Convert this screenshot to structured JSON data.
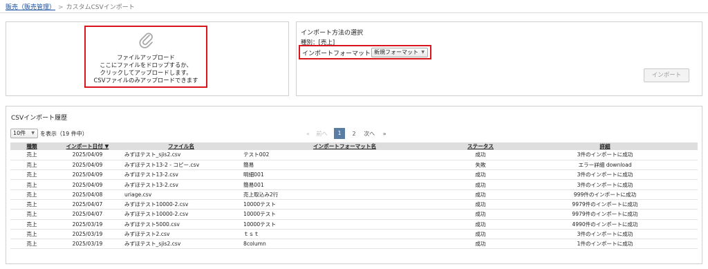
{
  "breadcrumb": {
    "root": "販売（販売管理）",
    "separator": ">",
    "current": "カスタムCSVインポート"
  },
  "upload": {
    "icon": "paperclip-icon",
    "title": "ファイルアップロード",
    "line1": "ここにファイルをドロップするか、",
    "line2": "クリックしてアップロードします。",
    "line3": "CSVファイルのみアップロードできます"
  },
  "import_method": {
    "title": "インポート方法の選択",
    "type_label": "種別：[売上]",
    "format_label": "インポートフォーマット：",
    "format_value": "新規フォーマット",
    "import_button": "インポート"
  },
  "history": {
    "title": "CSVインポート履歴",
    "per_page_value": "10件",
    "per_page_suffix": "を表示（19 件中）",
    "pager": {
      "first": "«",
      "prev": "前へ",
      "pages": [
        "1",
        "2"
      ],
      "current_page": "1",
      "next": "次へ",
      "last": "»"
    },
    "columns": [
      "種類",
      "インポート日付 ▼",
      "ファイル名",
      "インポートフォーマット名",
      "ステータス",
      "詳細"
    ],
    "rows": [
      [
        "売上",
        "2025/04/09",
        "みずほテスト_sjis2.csv",
        "テスト002",
        "成功",
        "3件のインポートに成功"
      ],
      [
        "売上",
        "2025/04/09",
        "みずほテスト13-2 - コピー.csv",
        "簡易",
        "失敗",
        "エラー詳細 download"
      ],
      [
        "売上",
        "2025/04/09",
        "みずほテスト13-2.csv",
        "明細001",
        "成功",
        "3件のインポートに成功"
      ],
      [
        "売上",
        "2025/04/09",
        "みずほテスト13-2.csv",
        "簡易001",
        "成功",
        "3件のインポートに成功"
      ],
      [
        "売上",
        "2025/04/08",
        "uriage.csv",
        "売上取込み2行",
        "成功",
        "999件のインポートに成功"
      ],
      [
        "売上",
        "2025/04/07",
        "みずほテスト10000-2.csv",
        "10000テスト",
        "成功",
        "9979件のインポートに成功"
      ],
      [
        "売上",
        "2025/04/07",
        "みずほテスト10000-2.csv",
        "10000テスト",
        "成功",
        "9979件のインポートに成功"
      ],
      [
        "売上",
        "2025/03/19",
        "みずほテスト5000.csv",
        "10000テスト",
        "成功",
        "4990件のインポートに成功"
      ],
      [
        "売上",
        "2025/03/19",
        "みずほテスト2.csv",
        "ｔｓｔ",
        "成功",
        "3件のインポートに成功"
      ],
      [
        "売上",
        "2025/03/19",
        "みずほテスト_sjis2.csv",
        "8column",
        "成功",
        "1件のインポートに成功"
      ]
    ]
  },
  "colors": {
    "highlight_border": "#d9141a",
    "link": "#2a6ebb",
    "active_page": "#5a7ea3",
    "header_bg": "#dedede"
  }
}
